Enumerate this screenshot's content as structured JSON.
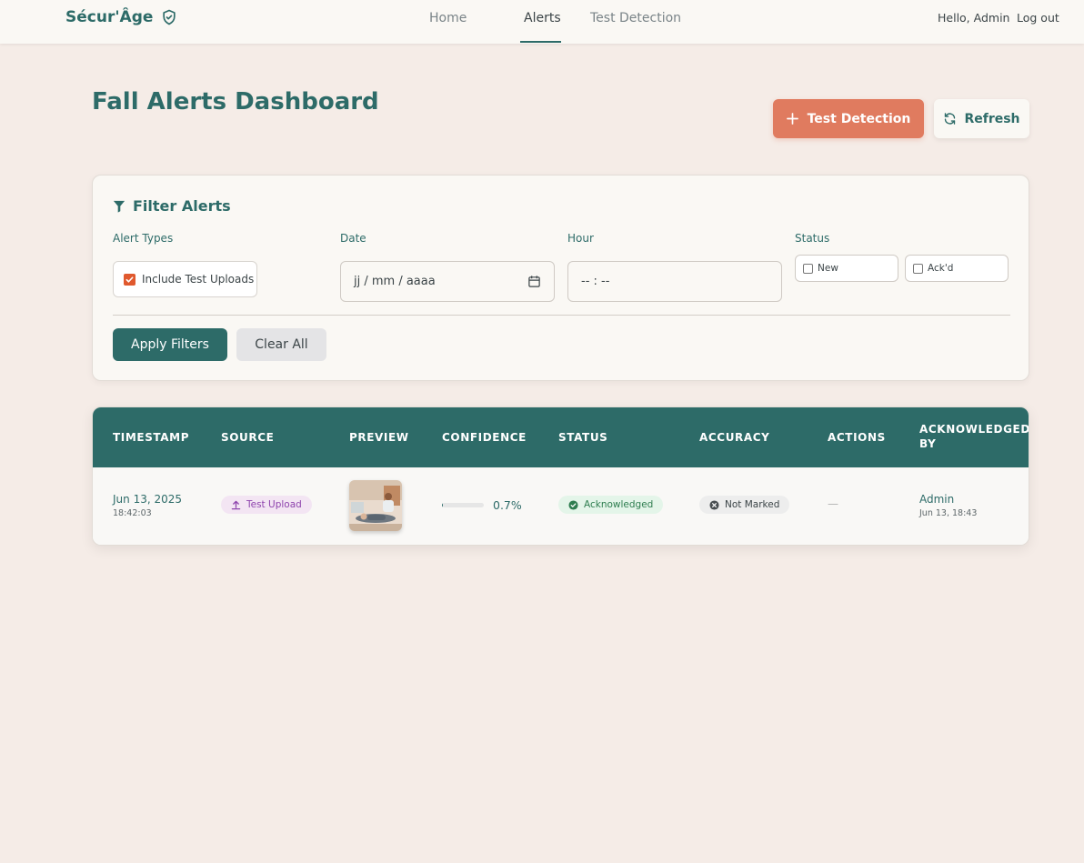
{
  "nav": {
    "brand": "Sécur'Âge",
    "links": [
      "Home",
      "Alerts",
      "Test Detection"
    ],
    "greeting": "Hello, Admin",
    "logout": "Log out"
  },
  "header": {
    "title": "Fall Alerts Dashboard",
    "test_button": "Test Detection",
    "refresh_button": "Refresh"
  },
  "filters": {
    "title": "Filter Alerts",
    "alert_types_label": "Alert Types",
    "include_test_uploads": "Include Test Uploads",
    "include_test_uploads_checked": true,
    "date_label": "Date",
    "date_placeholder": "jj / mm / aaaa",
    "hour_label": "Hour",
    "hour_placeholder": "-- : --",
    "status_label": "Status",
    "status_options": [
      "New",
      "Ack'd"
    ],
    "apply_button": "Apply Filters",
    "clear_button": "Clear All"
  },
  "table": {
    "headers": [
      "TIMESTAMP",
      "SOURCE",
      "PREVIEW",
      "CONFIDENCE",
      "STATUS",
      "ACCURACY",
      "ACTIONS",
      "ACKNOWLEDGED BY"
    ],
    "rows": [
      {
        "date": "Jun 13, 2025",
        "time": "18:42:03",
        "source": "Test Upload",
        "confidence": "0.7%",
        "confidence_fraction": 0.007,
        "status": "Acknowledged",
        "accuracy": "Not Marked",
        "actions": "—",
        "ack_by": "Admin",
        "ack_at": "Jun 13, 18:43"
      }
    ]
  },
  "colors": {
    "primary": "#2d6b68",
    "accent": "#e07b5f",
    "background": "#f5ece7"
  }
}
